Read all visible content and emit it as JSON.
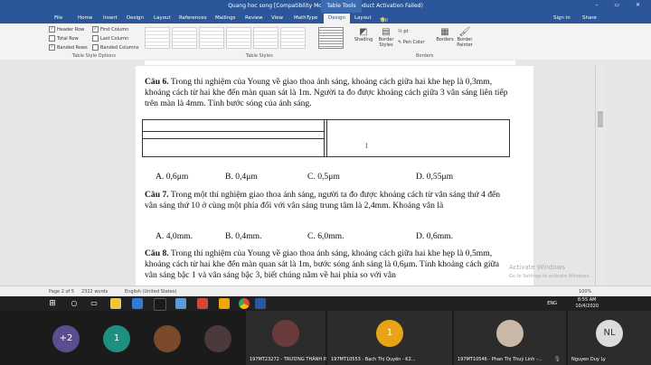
{
  "titlebar": {
    "file_title": "Quang hoc song [Compatibility Mode] - Word (Product Activation Failed)",
    "table_tools": "Table Tools",
    "window_controls": "–  ▭  ✕"
  },
  "ribbon_tabs": [
    "File",
    "Home",
    "Insert",
    "Design",
    "Layout",
    "References",
    "Mailings",
    "Review",
    "View",
    "MathType",
    "Design",
    "Layout"
  ],
  "tell_me": "Tell me what you want to do...",
  "account": {
    "sign_in": "Sign in",
    "share": "Share"
  },
  "table_style_options": {
    "items": [
      "Header Row",
      "First Column",
      "Total Row",
      "Last Column",
      "Banded Rows",
      "Banded Columns"
    ],
    "group_label": "Table Style Options"
  },
  "table_styles": {
    "group_label": "Table Styles"
  },
  "borders": {
    "shading": "Shading",
    "border_styles": "Border Styles",
    "pen_weight": "½ pt",
    "pen_color": "Pen Color",
    "borders_btn": "Borders",
    "painter": "Border Painter",
    "group_label": "Borders"
  },
  "document": {
    "q6": {
      "label": "Câu 6.",
      "text": "Trong thí nghiệm của Young về giao thoa ánh sáng, khoảng cách giữa hai khe hẹp là 0,3mm, khoảng cách từ hai khe đến màn quan sát là 1m. Người ta đo được khoảng cách giữa 3 vân sáng liên tiếp trên màn là 4mm. Tính bước sóng của ánh sáng."
    },
    "q6_answers": [
      "A. 0,6μm",
      "B. 0,4μm",
      "C. 0,5μm",
      "D. 0,55μm"
    ],
    "q7": {
      "label": "Câu 7.",
      "text": "Trong một thí nghiệm giao thoa ánh sáng, người ta đo được khoảng cách từ vân sáng thứ 4 đến vân sáng thứ 10 ở cùng một phía đối với vân sáng trung tâm là 2,4mm. Khoảng vân là"
    },
    "q7_answers": [
      "A. 4,0mm.",
      "B. 0,4mm.",
      "C. 6,0mm.",
      "D. 0,6mm."
    ],
    "q8": {
      "label": "Câu 8.",
      "text": "Trong thí nghiệm của Young về giao thoa ánh sáng, khoảng cách giữa hai khe hẹp là 0,5mm, khoảng cách từ hai khe đến màn quan sát là 1m, bước sóng ánh sáng là 0,6μm. Tính khoảng cách giữa vân sáng bậc 1 và vân sáng bậc 3, biết chúng nằm về hai phía so với vân"
    }
  },
  "status": {
    "page": "Page 2 of 5",
    "words": "2322 words",
    "language": "English (United States)",
    "zoom": "100%"
  },
  "activation": {
    "line1": "Activate Windows",
    "line2": "Go to Settings to activate Windows."
  },
  "clock": {
    "time": "8:55 AM",
    "date": "10/4/2020"
  },
  "tray_lang": "ENG",
  "participants": [
    {
      "avatar": "+2",
      "name": ""
    },
    {
      "avatar": "1",
      "name": ""
    },
    {
      "avatar": "",
      "name": ""
    },
    {
      "avatar": "",
      "name": ""
    },
    {
      "avatar": "",
      "name": "197MT23272 - TRƯƠNG THÀNH P..."
    },
    {
      "avatar": "1",
      "name": "197MT10553 - Bạch Thị Quyên - K2..."
    },
    {
      "avatar": "",
      "name": "197MT10546 - Phan Thị Thuý Linh -..."
    },
    {
      "avatar": "NL",
      "name": "Nguyen Duy Ly"
    }
  ],
  "colors": {
    "word_blue": "#2b579a",
    "meet_bg": "#1b1b1b",
    "avatar_teal": "#1f8f80",
    "avatar_purple": "#5c4d8f",
    "avatar_orange": "#e8a317",
    "avatar_gray": "#dcdcdc"
  }
}
